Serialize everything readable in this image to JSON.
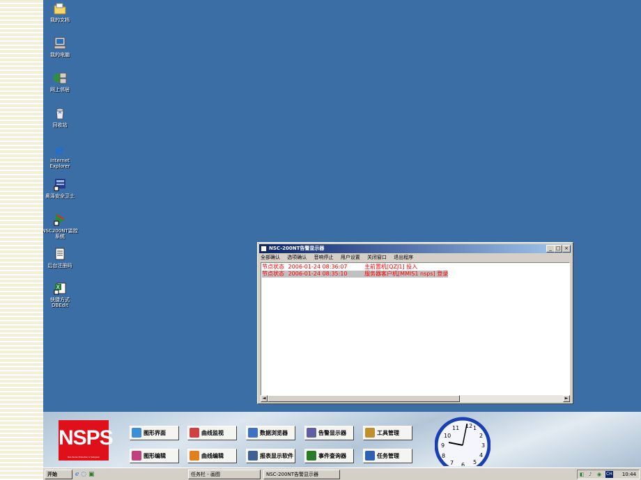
{
  "desktop": {
    "icons": [
      {
        "label": "我的文档",
        "icon": "folder-documents-icon"
      },
      {
        "label": "我的电脑",
        "icon": "computer-icon"
      },
      {
        "label": "网上邻居",
        "icon": "network-icon"
      },
      {
        "label": "回收站",
        "icon": "recycle-bin-icon"
      },
      {
        "label": "Internet Explorer",
        "icon": "ie-icon"
      },
      {
        "label": "奥泽安全卫士",
        "icon": "security-guard-icon"
      },
      {
        "label": "NSC200NT监控系统",
        "icon": "monitor-system-icon"
      },
      {
        "label": "后台注册码",
        "icon": "notepad-icon"
      },
      {
        "label": "快捷方式 DBEdit",
        "icon": "excel-shortcut-icon"
      }
    ]
  },
  "window": {
    "title": "NSC-200NT告警显示器",
    "controls": [
      "_",
      "□",
      "×"
    ],
    "menu": [
      "全部确认",
      "选项确认",
      "音响停止",
      "用户设置",
      "关闭窗口",
      "退出程序"
    ],
    "log": [
      {
        "type": "节点状态",
        "time": "2006-01-24 08:36:07",
        "message": "主前置机[QZJ1]   投入",
        "color": "#ff0000",
        "highlight": false
      },
      {
        "type": "节点状态",
        "time": "2006-01-24 08:35:10",
        "message": "服务器客户机[MMIS1 nsps]   登录",
        "color": "#ff0000",
        "highlight": true
      }
    ],
    "scroll_left": "◄",
    "scroll_right": "►"
  },
  "panel": {
    "logo": "NSPS",
    "logo_sub": "Non-Sense Protection & Subsytem",
    "buttons_row1": [
      {
        "label": "图形界面",
        "icon": "graphic-ui-icon",
        "color": "#3a8fd8"
      },
      {
        "label": "曲线监视",
        "icon": "curve-monitor-icon",
        "color": "#d04040"
      },
      {
        "label": "数据浏览器",
        "icon": "data-browser-icon",
        "color": "#4070c0"
      },
      {
        "label": "告警显示器",
        "icon": "alarm-display-icon",
        "color": "#6060a0"
      },
      {
        "label": "工具管理",
        "icon": "tool-manage-icon",
        "color": "#c09030"
      }
    ],
    "buttons_row2": [
      {
        "label": "图形编辑",
        "icon": "graphic-edit-icon",
        "color": "#c04080"
      },
      {
        "label": "曲线编辑",
        "icon": "curve-edit-icon",
        "color": "#e08020"
      },
      {
        "label": "报表显示软件",
        "icon": "report-display-icon",
        "color": "#406090"
      },
      {
        "label": "事件查询器",
        "icon": "event-query-icon",
        "color": "#2a7a2a"
      },
      {
        "label": "任务管理",
        "icon": "task-manage-icon",
        "color": "#3060b0"
      }
    ],
    "clock_numbers": [
      "12",
      "1",
      "2",
      "3",
      "4",
      "5",
      "6",
      "7",
      "8",
      "9",
      "10",
      "11"
    ]
  },
  "taskbar": {
    "start": "开始",
    "items": [
      "任务栏 - 画图",
      "NSC-200NT告警显示器"
    ],
    "lang": "CH",
    "time": "10:44"
  }
}
